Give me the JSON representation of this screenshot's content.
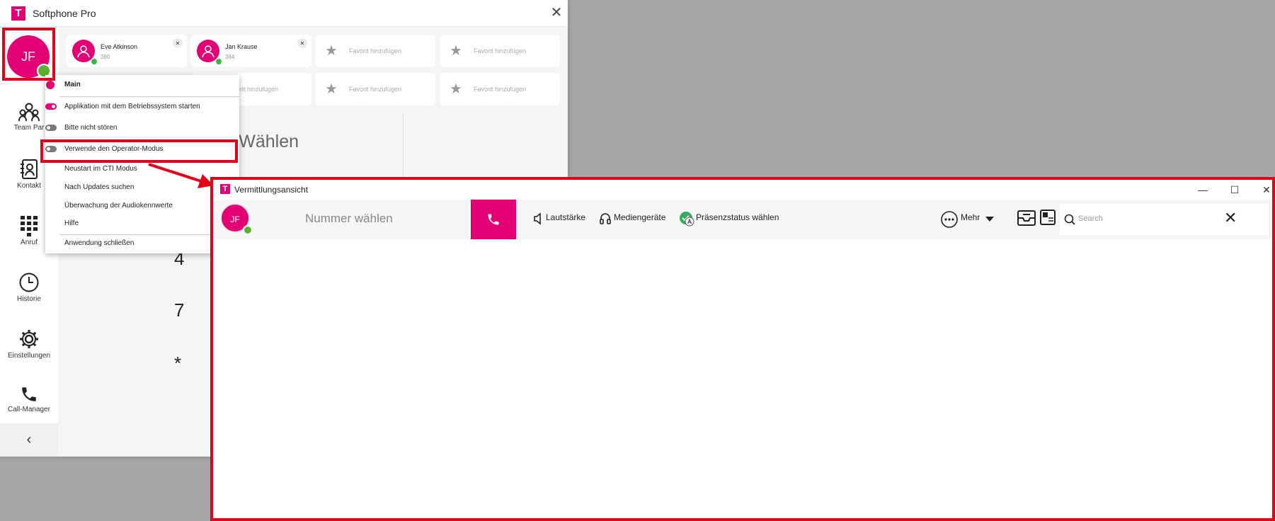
{
  "main_window": {
    "logo": "T",
    "title": "Softphone Pro",
    "close_glyph": "✕"
  },
  "sidebar": {
    "avatar_initials": "JF",
    "items": [
      {
        "label": "Team Par",
        "icon": "team-icon"
      },
      {
        "label": "Kontakt",
        "icon": "contacts-icon"
      },
      {
        "label": "Anruf",
        "icon": "dialpad-icon"
      },
      {
        "label": "Historie",
        "icon": "history-icon"
      },
      {
        "label": "Einstellungen",
        "icon": "gear-icon"
      },
      {
        "label": "Call-Manager",
        "icon": "phone-icon"
      }
    ],
    "collapse_glyph": "‹"
  },
  "favorites": {
    "contacts": [
      {
        "name": "Eve Atkinson",
        "ext": "380"
      },
      {
        "name": "Jan Krause",
        "ext": "384"
      }
    ],
    "add_label": "Favorit hinzufügen",
    "add_label_partial": "orit hinzufügen",
    "remove_glyph": "×"
  },
  "dialer": {
    "title_partial": "r Wählen",
    "keys": [
      "4",
      "7",
      "*"
    ]
  },
  "context_menu": {
    "items": [
      {
        "label": "Main",
        "control": "dot"
      },
      {
        "label": "Applikation mit dem Betriebssystem starten",
        "control": "toggle-on"
      },
      {
        "label": "Bitte nicht stören",
        "control": "toggle-off"
      },
      {
        "label": "Verwende den Operator-Modus",
        "control": "toggle-off"
      },
      {
        "label": "Neustart im CTI Modus"
      },
      {
        "label": "Nach Updates suchen"
      },
      {
        "label": "Überwachung der Audiokennwerte"
      },
      {
        "label": "Hilfe"
      },
      {
        "label": "Anwendung schließen"
      }
    ]
  },
  "operator_window": {
    "logo": "T",
    "title": "Vermittlungsansicht",
    "controls": [
      "—",
      "☐",
      "✕"
    ],
    "avatar_initials": "JF",
    "dial_placeholder": "Nummer wählen",
    "tools": {
      "volume": "Lautstärke",
      "media": "Mediengeräte",
      "presence": "Präsenzstatus wählen",
      "more": "Mehr"
    },
    "search_placeholder": "Search",
    "search_clear_glyph": "✕"
  },
  "colors": {
    "brand_magenta": "#e20074",
    "highlight_red": "#e3001b",
    "presence_green": "#60b030"
  }
}
